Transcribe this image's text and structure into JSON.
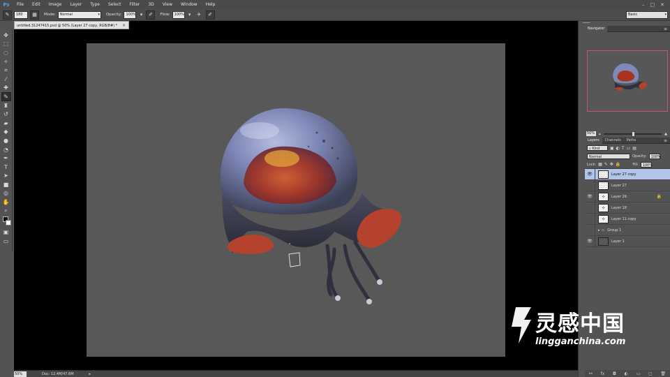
{
  "app": {
    "logo": "Ps"
  },
  "menu": [
    "File",
    "Edit",
    "Image",
    "Layer",
    "Type",
    "Select",
    "Filter",
    "3D",
    "View",
    "Window",
    "Help"
  ],
  "window_controls": [
    "–",
    "□",
    "✕"
  ],
  "options": {
    "brush_size": "180",
    "mode_label": "Mode:",
    "mode_value": "Normal",
    "opacity_label": "Opacity:",
    "opacity_value": "100%",
    "flow_label": "Flow:",
    "flow_value": "100%",
    "workspace": "Basic"
  },
  "document": {
    "tab_title": "untitled.31247415.psd @ 50% (Layer 27 copy, RGB/8#) *",
    "zoom": "50%",
    "doc_size": "Doc: 12.4M/47.6M"
  },
  "navigator": {
    "tab": "Navigator",
    "zoom": "50%"
  },
  "layers_panel": {
    "tabs": [
      "Layers",
      "Channels",
      "Paths"
    ],
    "kind_label": "Kind",
    "blend_mode": "Normal",
    "opacity_label": "Opacity:",
    "opacity_value": "100%",
    "lock_label": "Lock:",
    "fill_label": "Fill:",
    "fill_value": "100%",
    "layers": [
      {
        "name": "Layer 27 copy",
        "visible": true,
        "selected": true,
        "thumb": "dots"
      },
      {
        "name": "Layer 27",
        "visible": false,
        "selected": false,
        "thumb": "dots"
      },
      {
        "name": "Layer 26",
        "visible": true,
        "selected": false,
        "thumb": "sketch",
        "locked": true
      },
      {
        "name": "Layer 18",
        "visible": false,
        "selected": false,
        "thumb": "sketch"
      },
      {
        "name": "Layer 11 copy",
        "visible": false,
        "selected": false,
        "thumb": "sketch"
      },
      {
        "name": "Group 1",
        "visible": false,
        "selected": false,
        "thumb": "folder"
      },
      {
        "name": "Layer 1",
        "visible": true,
        "selected": false,
        "thumb": "gray"
      }
    ]
  },
  "watermark": {
    "brand_cn": "灵感中国",
    "url": "lingganchina.com"
  },
  "colors": {
    "canvas_bg": "#585858",
    "selection": "#b2c4e8",
    "navigator_frame": "#c9566e"
  }
}
